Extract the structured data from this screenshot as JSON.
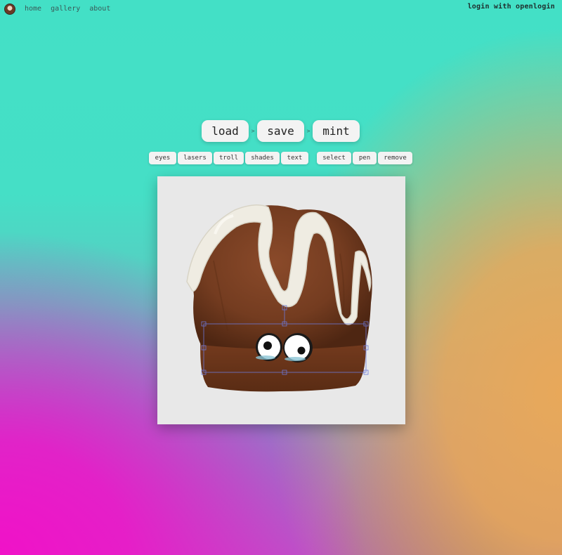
{
  "nav": {
    "avatar": "avatar-icon",
    "items": [
      "home",
      "gallery",
      "about"
    ]
  },
  "login": "login with openlogin",
  "steps": {
    "load": "load",
    "save": "save",
    "mint": "mint",
    "arrow": ">"
  },
  "tools": {
    "left": [
      "eyes",
      "lasers",
      "troll",
      "shades",
      "text"
    ],
    "right": [
      "select",
      "pen",
      "remove"
    ]
  },
  "canvas": {
    "background": "#e8e8e8",
    "subject": "chocolate-cake-with-icing",
    "sticker": "googly-eyes",
    "selection_color": "#6c78d8"
  }
}
